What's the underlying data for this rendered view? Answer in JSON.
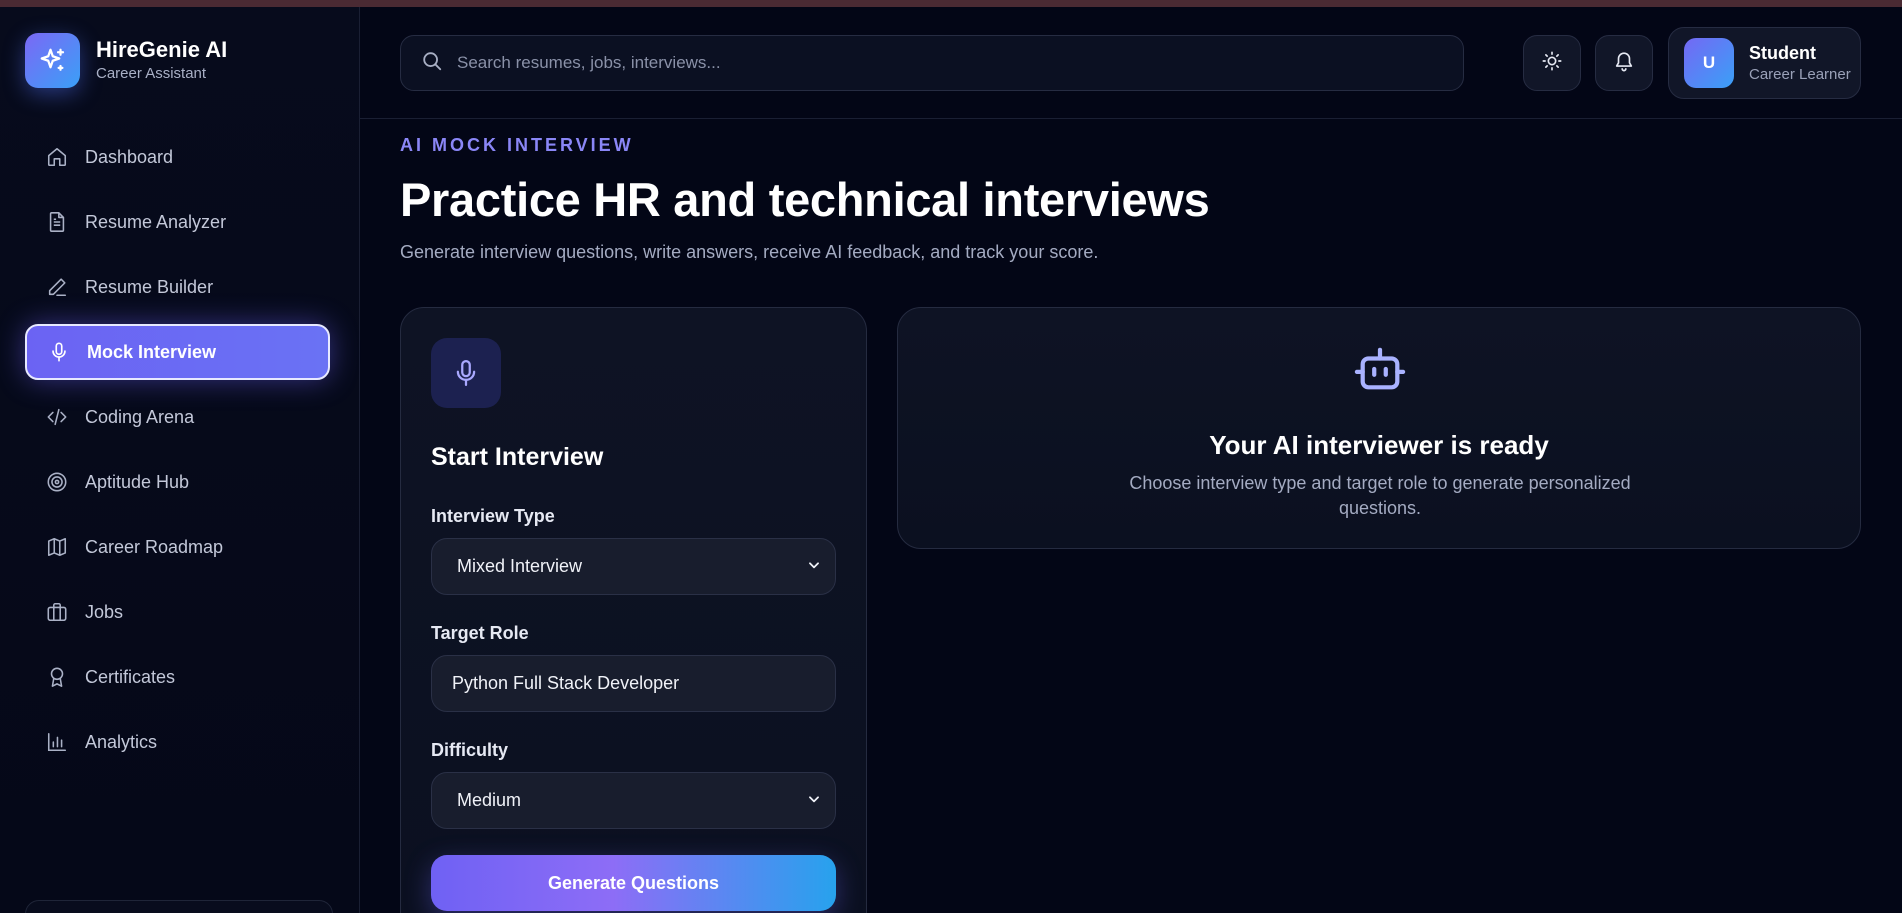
{
  "app": {
    "title": "HireGenie AI",
    "subtitle": "Career Assistant"
  },
  "sidebar": {
    "items": [
      {
        "label": "Dashboard",
        "icon": "home-icon",
        "active": false
      },
      {
        "label": "Resume Analyzer",
        "icon": "document-icon",
        "active": false
      },
      {
        "label": "Resume Builder",
        "icon": "pencil-icon",
        "active": false
      },
      {
        "label": "Mock Interview",
        "icon": "microphone-icon",
        "active": true
      },
      {
        "label": "Coding Arena",
        "icon": "code-icon",
        "active": false
      },
      {
        "label": "Aptitude Hub",
        "icon": "target-icon",
        "active": false
      },
      {
        "label": "Career Roadmap",
        "icon": "map-icon",
        "active": false
      },
      {
        "label": "Jobs",
        "icon": "briefcase-icon",
        "active": false
      },
      {
        "label": "Certificates",
        "icon": "award-icon",
        "active": false
      },
      {
        "label": "Analytics",
        "icon": "bar-chart-icon",
        "active": false
      }
    ]
  },
  "header": {
    "search_placeholder": "Search resumes, jobs, interviews...",
    "user": {
      "initial": "U",
      "name": "Student",
      "role": "Career Learner"
    }
  },
  "main": {
    "eyebrow": "AI MOCK INTERVIEW",
    "title": "Practice HR and technical interviews",
    "subtitle": "Generate interview questions, write answers, receive AI feedback, and track your score."
  },
  "start_card": {
    "title": "Start Interview",
    "interview_type_label": "Interview Type",
    "interview_type_value": "Mixed Interview",
    "target_role_label": "Target Role",
    "target_role_value": "Python Full Stack Developer",
    "difficulty_label": "Difficulty",
    "difficulty_value": "Medium",
    "button_label": "Generate Questions"
  },
  "ready_card": {
    "title": "Your AI interviewer is ready",
    "description": "Choose interview type and target role to generate personalized questions."
  },
  "colors": {
    "background": "#030616",
    "accent": "#6b63f3",
    "accent_secondary": "#3aa0f7",
    "eyebrow": "#8a86f6"
  }
}
